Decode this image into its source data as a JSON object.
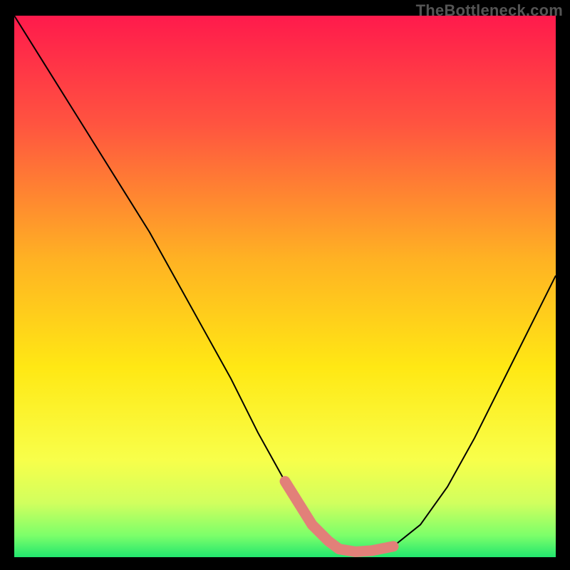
{
  "watermark": "TheBottleneck.com",
  "chart_data": {
    "type": "line",
    "title": "",
    "xlabel": "",
    "ylabel": "",
    "xlim": [
      0,
      100
    ],
    "ylim": [
      0,
      100
    ],
    "gradient_stops": [
      {
        "offset": 0.0,
        "color": "#ff1a4c"
      },
      {
        "offset": 0.2,
        "color": "#ff5440"
      },
      {
        "offset": 0.45,
        "color": "#ffb223"
      },
      {
        "offset": 0.65,
        "color": "#ffe814"
      },
      {
        "offset": 0.82,
        "color": "#f8ff4a"
      },
      {
        "offset": 0.9,
        "color": "#d1ff5e"
      },
      {
        "offset": 0.96,
        "color": "#7cff6a"
      },
      {
        "offset": 1.0,
        "color": "#22e66e"
      }
    ],
    "series": [
      {
        "name": "bottleneck-curve",
        "x": [
          0,
          5,
          10,
          15,
          20,
          25,
          30,
          35,
          40,
          45,
          50,
          55,
          58,
          60,
          63,
          66,
          70,
          75,
          80,
          85,
          90,
          95,
          100
        ],
        "y": [
          100,
          92,
          84,
          76,
          68,
          60,
          51,
          42,
          33,
          23,
          14,
          6,
          3,
          1.5,
          1,
          1.2,
          2,
          6,
          13,
          22,
          32,
          42,
          52
        ]
      }
    ],
    "marker_band": {
      "name": "optimal-range",
      "color": "#e28079",
      "x": [
        50,
        55,
        58,
        60,
        63,
        66,
        70
      ],
      "y": [
        14,
        6,
        3,
        1.5,
        1,
        1.2,
        2
      ]
    }
  }
}
